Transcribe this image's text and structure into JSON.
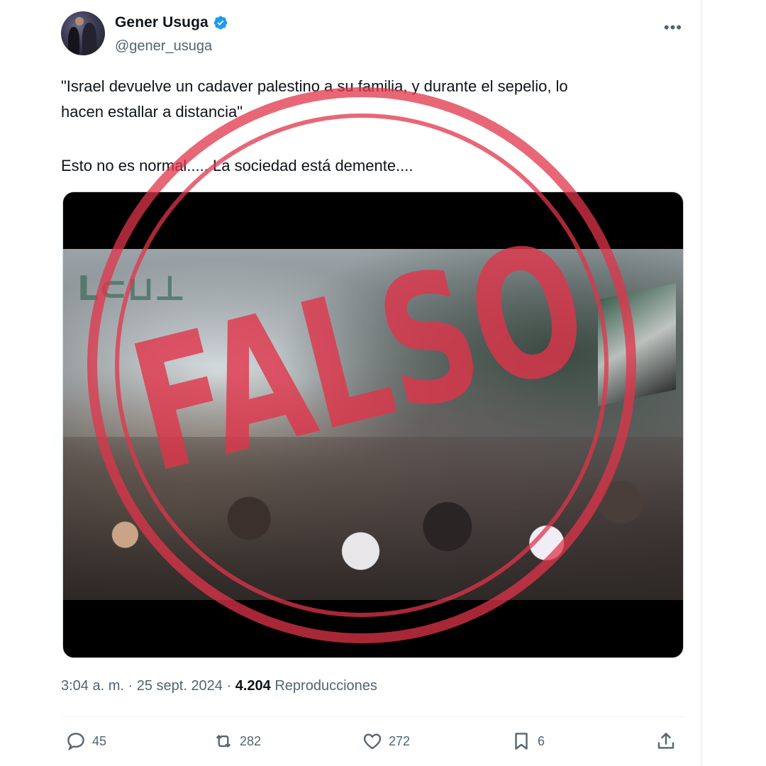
{
  "author": {
    "display_name": "Gener Usuga",
    "handle": "@gener_usuga",
    "verified": true
  },
  "tweet": {
    "line1": "\"Israel devuelve un cadaver palestino a su familia, y durante el sepelio, lo",
    "line2": "hacen estallar a distancia\"",
    "line3": "Esto no es normal..... La sociedad está demente...."
  },
  "media": {
    "banner_text": "ᒪ⊂⊔⊥"
  },
  "stamp": {
    "text": "FALSO",
    "color": "#e0344a"
  },
  "meta": {
    "time": "3:04 a. m.",
    "separator": " · ",
    "date": "25 sept. 2024",
    "views_count": "4.204",
    "views_label": "Reproducciones"
  },
  "actions": {
    "replies": "45",
    "retweets": "282",
    "likes": "272",
    "bookmarks": "6"
  },
  "colors": {
    "secondary_text": "#536471",
    "primary_text": "#0f1419",
    "verified_blue": "#1d9bf0"
  }
}
